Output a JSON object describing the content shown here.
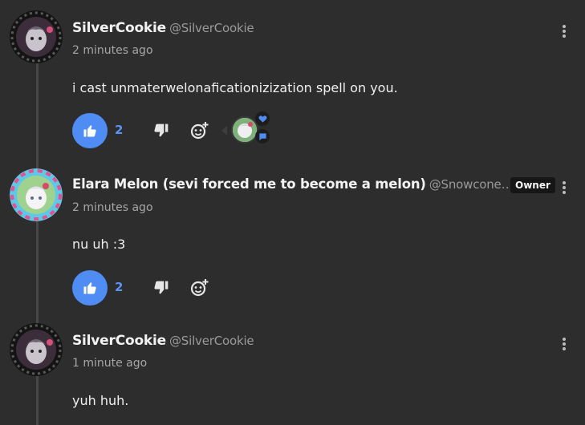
{
  "comments": [
    {
      "name": "SilverCookie",
      "handle": "@SilverCookie",
      "time": "2 minutes ago",
      "text": "i cast unmaterwelonaficationizization spell on you.",
      "likes": "2"
    },
    {
      "name": "Elara Melon (sevi forced me to become a melon)",
      "handle": "@Snowcone…",
      "badge": "Owner",
      "time": "2 minutes ago",
      "text": "nu uh :3",
      "likes": "2"
    },
    {
      "name": "SilverCookie",
      "handle": "@SilverCookie",
      "time": "1 minute ago",
      "text": "yuh huh."
    }
  ],
  "colors": {
    "background": "#2d2d2d",
    "like_accent": "#4f8cf4",
    "reaction_heart": "#4f8cf4"
  },
  "icons": {
    "like": "thumbs-up-icon",
    "dislike": "thumbs-down-icon",
    "react": "add-reaction-icon",
    "menu": "kebab-menu-icon",
    "reaction_heart": "heart-icon",
    "reaction_chat": "chat-bubble-icon"
  }
}
